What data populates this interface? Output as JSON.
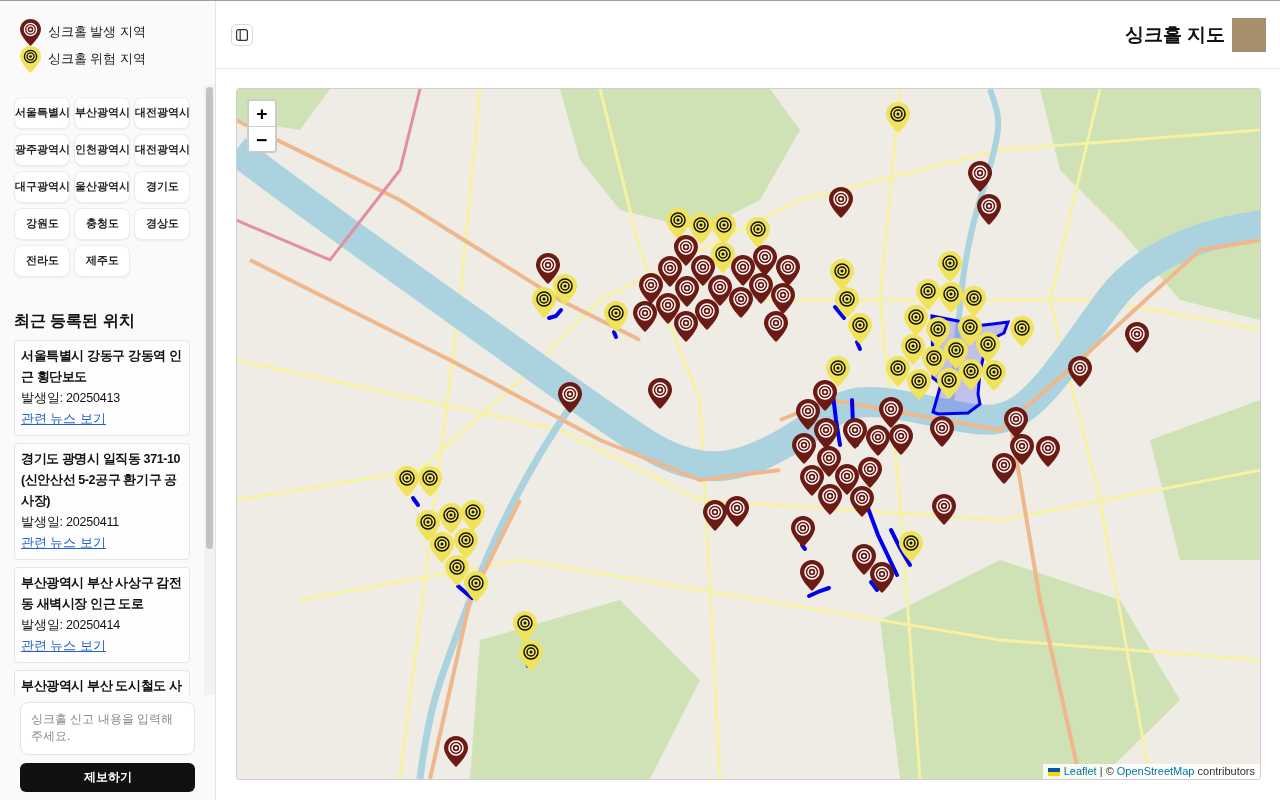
{
  "legend": [
    {
      "kind": "occurred",
      "label": "싱크홀 발생 지역",
      "color": "#6b1a14"
    },
    {
      "kind": "risk",
      "label": "싱크홀 위험 지역",
      "color": "#f0e35a"
    }
  ],
  "regions": [
    "서울특별시",
    "부산광역시",
    "대전광역시",
    "광주광역시",
    "인천광역시",
    "대전광역시",
    "대구광역시",
    "울산광역시",
    "경기도",
    "강원도",
    "충청도",
    "경상도",
    "전라도",
    "제주도"
  ],
  "recent": {
    "title": "최근 등록된 위치",
    "items": [
      {
        "title": "서울특별시 강동구 강동역 인근 횡단보도",
        "date": "발생일: 20250413",
        "link": "관련 뉴스 보기"
      },
      {
        "title": "경기도 광명시 일직동 371-10 (신안산선 5-2공구 환기구 공사장)",
        "date": "발생일: 20250411",
        "link": "관련 뉴스 보기"
      },
      {
        "title": "부산광역시 부산 사상구 감전동 새벽시장 인근 도로",
        "date": "발생일: 20250414",
        "link": "관련 뉴스 보기"
      },
      {
        "title": "부산광역시 부산 도시철도 사"
      }
    ]
  },
  "report": {
    "placeholder": "싱크홀 신고 내용을 입력해주세요.",
    "button": "제보하기"
  },
  "header": {
    "title": "싱크홀 지도"
  },
  "map": {
    "zoom_in": "+",
    "zoom_out": "−",
    "markers": [
      {
        "kind": "risk"
      },
      {
        "kind": "occurred"
      },
      {
        "kind": "occurred"
      },
      {
        "kind": "occurred"
      },
      {
        "kind": "risk"
      },
      {
        "kind": "risk"
      },
      {
        "kind": "risk"
      },
      {
        "kind": "risk"
      },
      {
        "kind": "occurred"
      },
      {
        "kind": "risk"
      },
      {
        "kind": "occurred"
      },
      {
        "kind": "risk"
      },
      {
        "kind": "occurred"
      },
      {
        "kind": "occurred"
      },
      {
        "kind": "occurred"
      },
      {
        "kind": "occurred"
      },
      {
        "kind": "occurred"
      },
      {
        "kind": "risk"
      },
      {
        "kind": "occurred"
      },
      {
        "kind": "occurred"
      },
      {
        "kind": "occurred"
      },
      {
        "kind": "occurred"
      },
      {
        "kind": "risk"
      },
      {
        "kind": "occurred"
      },
      {
        "kind": "risk"
      },
      {
        "kind": "risk"
      },
      {
        "kind": "risk"
      },
      {
        "kind": "risk"
      },
      {
        "kind": "occurred"
      },
      {
        "kind": "occurred"
      },
      {
        "kind": "occurred"
      },
      {
        "kind": "occurred"
      },
      {
        "kind": "occurred"
      },
      {
        "kind": "risk"
      },
      {
        "kind": "occurred"
      },
      {
        "kind": "risk"
      },
      {
        "kind": "risk"
      },
      {
        "kind": "risk"
      },
      {
        "kind": "risk"
      },
      {
        "kind": "risk"
      },
      {
        "kind": "risk"
      },
      {
        "kind": "occurred"
      },
      {
        "kind": "risk"
      },
      {
        "kind": "risk"
      },
      {
        "kind": "risk"
      },
      {
        "kind": "risk"
      },
      {
        "kind": "risk"
      },
      {
        "kind": "risk"
      },
      {
        "kind": "risk"
      },
      {
        "kind": "risk"
      },
      {
        "kind": "occurred"
      },
      {
        "kind": "risk"
      },
      {
        "kind": "risk"
      },
      {
        "kind": "occurred"
      },
      {
        "kind": "occurred"
      },
      {
        "kind": "occurred"
      },
      {
        "kind": "occurred"
      },
      {
        "kind": "occurred"
      },
      {
        "kind": "occurred"
      },
      {
        "kind": "occurred"
      },
      {
        "kind": "occurred"
      },
      {
        "kind": "occurred"
      },
      {
        "kind": "occurred"
      },
      {
        "kind": "occurred"
      },
      {
        "kind": "occurred"
      },
      {
        "kind": "occurred"
      },
      {
        "kind": "occurred"
      },
      {
        "kind": "occurred"
      },
      {
        "kind": "occurred"
      },
      {
        "kind": "occurred"
      },
      {
        "kind": "occurred"
      },
      {
        "kind": "occurred"
      },
      {
        "kind": "risk"
      },
      {
        "kind": "risk"
      },
      {
        "kind": "occurred"
      },
      {
        "kind": "occurred"
      },
      {
        "kind": "occurred"
      },
      {
        "kind": "occurred"
      },
      {
        "kind": "occurred"
      },
      {
        "kind": "risk"
      },
      {
        "kind": "risk"
      },
      {
        "kind": "risk"
      },
      {
        "kind": "occurred"
      },
      {
        "kind": "risk"
      },
      {
        "kind": "risk"
      },
      {
        "kind": "risk"
      },
      {
        "kind": "risk"
      },
      {
        "kind": "occurred"
      },
      {
        "kind": "occurred"
      },
      {
        "kind": "occurred"
      },
      {
        "kind": "risk"
      },
      {
        "kind": "risk"
      },
      {
        "kind": "risk"
      },
      {
        "kind": "occurred"
      }
    ],
    "attribution": {
      "leaflet": "Leaflet",
      "separator": "| ©",
      "osm": "OpenStreetMap",
      "suffix": "contributors"
    }
  }
}
